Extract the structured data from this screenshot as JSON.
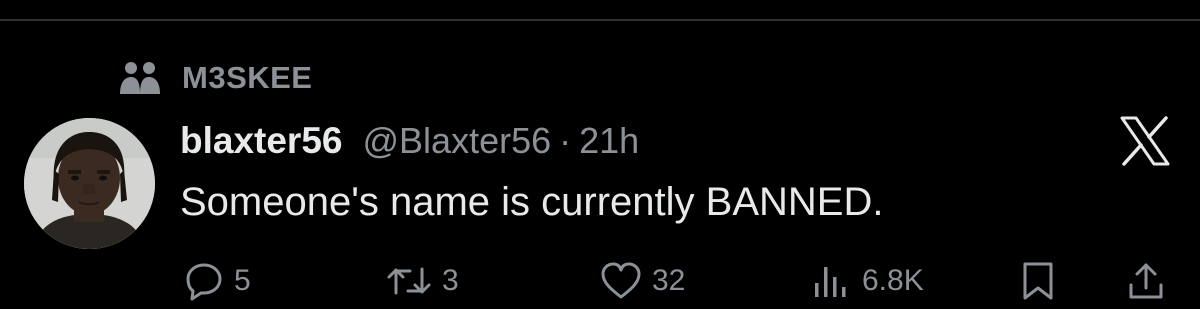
{
  "community": {
    "name": "M3SKEE",
    "icon": "community-icon"
  },
  "tweet": {
    "display_name": "blaxter56",
    "handle": "@Blaxter56",
    "separator": "·",
    "time": "21h",
    "text": "Someone's name is currently BANNED.",
    "avatar": "user-avatar"
  },
  "platform": {
    "logo": "x-logo-icon"
  },
  "actions": {
    "replies": "5",
    "reposts": "3",
    "likes": "32",
    "views": "6.8K",
    "reply_icon": "reply-icon",
    "repost_icon": "repost-icon",
    "like_icon": "heart-icon",
    "views_icon": "views-icon",
    "bookmark_icon": "bookmark-icon",
    "share_icon": "share-icon"
  },
  "colors": {
    "background": "#000000",
    "primary_text": "#e7e9ea",
    "secondary_text": "#8b9196",
    "divider": "#2f3336"
  }
}
